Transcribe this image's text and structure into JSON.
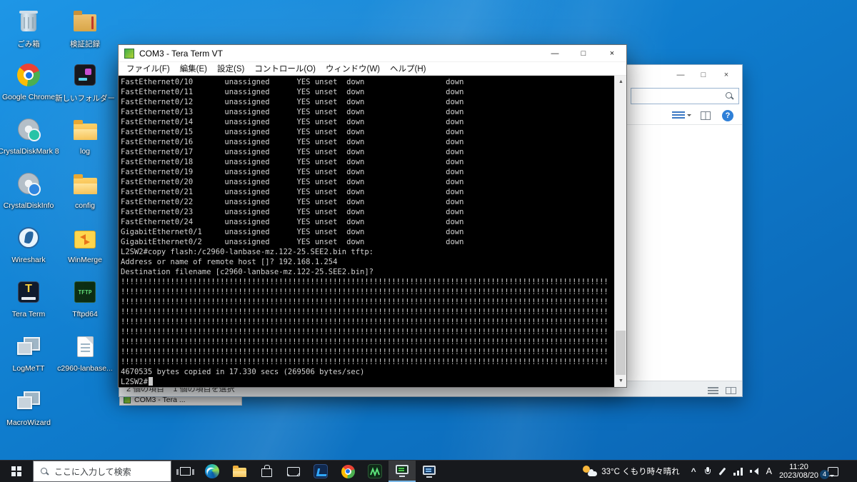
{
  "window_glyphs": {
    "minimize": "—",
    "maximize": "□",
    "close": "×",
    "scroll_up": "▲",
    "scroll_down": "▼",
    "chevron_up": "^"
  },
  "icon_glyphs": {
    "teraterm_t": "T",
    "tftp": "TFTP"
  },
  "desktop": {
    "icons": [
      {
        "label": "ごみ箱"
      },
      {
        "label": "検証記録"
      },
      {
        "label": "Google Chrome"
      },
      {
        "label": "新しいフォルダー"
      },
      {
        "label": "CrystalDiskMark 8"
      },
      {
        "label": "log"
      },
      {
        "label": "CrystalDiskInfo"
      },
      {
        "label": "config"
      },
      {
        "label": "Wireshark"
      },
      {
        "label": "WinMerge"
      },
      {
        "label": "Tera Term"
      },
      {
        "label": "Tftpd64"
      },
      {
        "label": "LogMeTT"
      },
      {
        "label": "c2960-lanbase..."
      },
      {
        "label": "MacroWizard"
      }
    ]
  },
  "teraterm": {
    "title": "COM3 - Tera Term VT",
    "menu": [
      "ファイル(F)",
      "編集(E)",
      "設定(S)",
      "コントロール(O)",
      "ウィンドウ(W)",
      "ヘルプ(H)"
    ],
    "terminal_lines": [
      "FastEthernet0/10       unassigned      YES unset  down                  down",
      "FastEthernet0/11       unassigned      YES unset  down                  down",
      "FastEthernet0/12       unassigned      YES unset  down                  down",
      "FastEthernet0/13       unassigned      YES unset  down                  down",
      "FastEthernet0/14       unassigned      YES unset  down                  down",
      "FastEthernet0/15       unassigned      YES unset  down                  down",
      "FastEthernet0/16       unassigned      YES unset  down                  down",
      "FastEthernet0/17       unassigned      YES unset  down                  down",
      "FastEthernet0/18       unassigned      YES unset  down                  down",
      "FastEthernet0/19       unassigned      YES unset  down                  down",
      "FastEthernet0/20       unassigned      YES unset  down                  down",
      "FastEthernet0/21       unassigned      YES unset  down                  down",
      "FastEthernet0/22       unassigned      YES unset  down                  down",
      "FastEthernet0/23       unassigned      YES unset  down                  down",
      "FastEthernet0/24       unassigned      YES unset  down                  down",
      "GigabitEthernet0/1     unassigned      YES unset  down                  down",
      "GigabitEthernet0/2     unassigned      YES unset  down                  down",
      "L2SW2#copy flash:/c2960-lanbase-mz.122-25.SEE2.bin tftp:",
      "Address or name of remote host []? 192.168.1.254",
      "Destination filename [c2960-lanbase-mz.122-25.SEE2.bin]? ",
      "!!!!!!!!!!!!!!!!!!!!!!!!!!!!!!!!!!!!!!!!!!!!!!!!!!!!!!!!!!!!!!!!!!!!!!!!!!!!!!!!!!!!!!!!!!!!!!!!!!!!!!!!!!!!",
      "!!!!!!!!!!!!!!!!!!!!!!!!!!!!!!!!!!!!!!!!!!!!!!!!!!!!!!!!!!!!!!!!!!!!!!!!!!!!!!!!!!!!!!!!!!!!!!!!!!!!!!!!!!!!",
      "!!!!!!!!!!!!!!!!!!!!!!!!!!!!!!!!!!!!!!!!!!!!!!!!!!!!!!!!!!!!!!!!!!!!!!!!!!!!!!!!!!!!!!!!!!!!!!!!!!!!!!!!!!!!",
      "!!!!!!!!!!!!!!!!!!!!!!!!!!!!!!!!!!!!!!!!!!!!!!!!!!!!!!!!!!!!!!!!!!!!!!!!!!!!!!!!!!!!!!!!!!!!!!!!!!!!!!!!!!!!",
      "!!!!!!!!!!!!!!!!!!!!!!!!!!!!!!!!!!!!!!!!!!!!!!!!!!!!!!!!!!!!!!!!!!!!!!!!!!!!!!!!!!!!!!!!!!!!!!!!!!!!!!!!!!!!",
      "!!!!!!!!!!!!!!!!!!!!!!!!!!!!!!!!!!!!!!!!!!!!!!!!!!!!!!!!!!!!!!!!!!!!!!!!!!!!!!!!!!!!!!!!!!!!!!!!!!!!!!!!!!!!",
      "!!!!!!!!!!!!!!!!!!!!!!!!!!!!!!!!!!!!!!!!!!!!!!!!!!!!!!!!!!!!!!!!!!!!!!!!!!!!!!!!!!!!!!!!!!!!!!!!!!!!!!!!!!!!",
      "!!!!!!!!!!!!!!!!!!!!!!!!!!!!!!!!!!!!!!!!!!!!!!!!!!!!!!!!!!!!!!!!!!!!!!!!!!!!!!!!!!!!!!!!!!!!!!!!!!!!!!!!!!!!",
      "!!!!!!!!!!!!!!!!!!!!!!!!!!!!!!!!!!!!!!!!!!!!!!!!!!!!!!!!!!!!!!!!!!!!!!!!!!!!!!!!!!!!!!!!!!!!!!!!!!!!!!!!!!!!",
      "4670535 bytes copied in 17.330 secs (269506 bytes/sec)"
    ],
    "prompt": "L2SW2#"
  },
  "explorer": {
    "status_text": "2 個の項目    1 個の項目を選択 ",
    "help_glyph": "?"
  },
  "background_window": {
    "title": "COM3 - Tera ..."
  },
  "taskbar": {
    "search_placeholder": "ここに入力して検索",
    "weather": "33°C くもり時々晴れ",
    "ime": "A",
    "time": "11:20",
    "date": "2023/08/20",
    "notification_count": "4"
  }
}
